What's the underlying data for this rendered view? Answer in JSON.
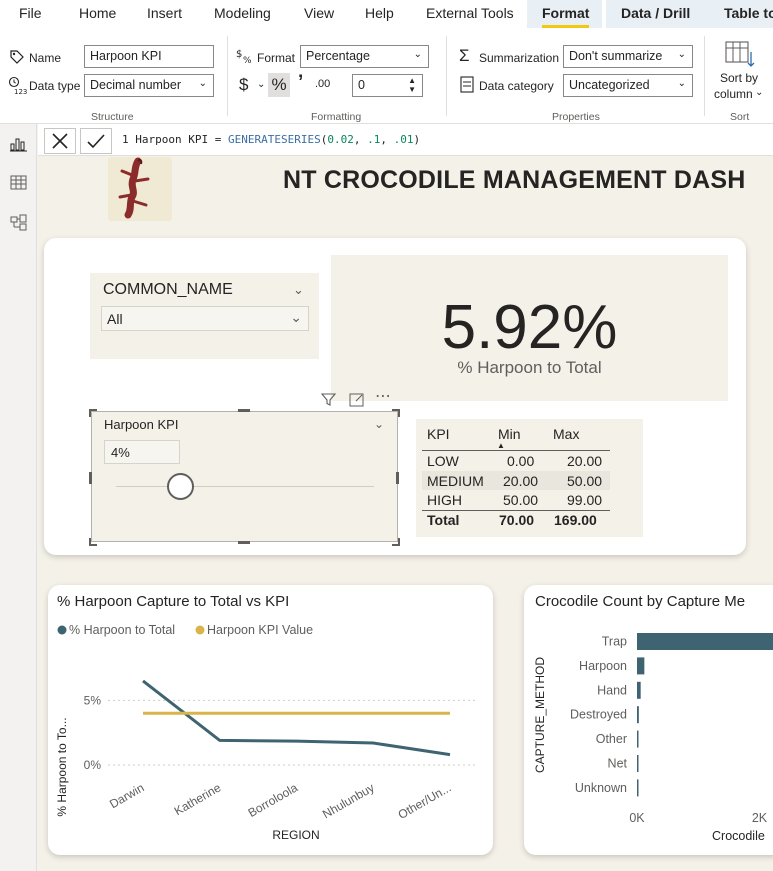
{
  "menu": {
    "items": [
      "File",
      "Home",
      "Insert",
      "Modeling",
      "View",
      "Help",
      "External Tools",
      "Format",
      "Data / Drill",
      "Table to"
    ],
    "active": "Format"
  },
  "ribbon": {
    "structure": {
      "title": "Structure",
      "name_label": "Name",
      "name_value": "Harpoon KPI",
      "datatype_label": "Data type",
      "datatype_value": "Decimal number"
    },
    "formatting": {
      "title": "Formatting",
      "format_label": "Format",
      "format_value": "Percentage",
      "currency_symbol": "$",
      "percent_symbol": "%",
      "comma_symbol": "’",
      "decimals_symbol": ".00",
      "decimals_value": "0"
    },
    "properties": {
      "title": "Properties",
      "summarization_label": "Summarization",
      "summarization_value": "Don't summarize",
      "category_label": "Data category",
      "category_value": "Uncategorized"
    },
    "sort": {
      "title": "Sort",
      "label_line1": "Sort by",
      "label_line2": "column"
    }
  },
  "formula": {
    "line": "1",
    "name": "Harpoon KPI",
    "eq": " = ",
    "fn": "GENERATESERIES",
    "open": "(",
    "a1": "0.02",
    "a2": ".1",
    "a3": ".01",
    "sep": ", ",
    "close": ")"
  },
  "dashboard": {
    "title": "NT CROCODILE MANAGEMENT DASH",
    "slicer": {
      "header": "COMMON_NAME",
      "value": "All"
    },
    "kpi": {
      "value": "5.92%",
      "caption": "% Harpoon to Total"
    },
    "parameter": {
      "title": "Harpoon KPI",
      "value": "4%",
      "level": 0.25
    },
    "kpi_table": {
      "headers": [
        "KPI",
        "Min",
        "Max"
      ],
      "rows": [
        {
          "kpi": "LOW",
          "min": "0.00",
          "max": "20.00"
        },
        {
          "kpi": "MEDIUM",
          "min": "20.00",
          "max": "50.00"
        },
        {
          "kpi": "HIGH",
          "min": "50.00",
          "max": "99.00"
        }
      ],
      "total": {
        "kpi": "Total",
        "min": "70.00",
        "max": "169.00"
      }
    }
  },
  "colors": {
    "series_primary": "#3e6471",
    "series_kpi": "#d9b44a",
    "accent_tab": "#f2c811"
  },
  "chart_data": [
    {
      "type": "line",
      "title": "% Harpoon Capture to Total vs KPI",
      "xlabel": "REGION",
      "ylabel": "% Harpoon to To...",
      "categories": [
        "Darwin",
        "Katherine",
        "Borroloola",
        "Nhulunbuy",
        "Other/Un..."
      ],
      "series": [
        {
          "name": "% Harpoon to Total",
          "values": [
            6.5,
            1.9,
            1.85,
            1.7,
            0.8
          ],
          "color": "#3e6471"
        },
        {
          "name": "Harpoon KPI Value",
          "values": [
            4,
            4,
            4,
            4,
            4
          ],
          "color": "#d9b44a"
        }
      ],
      "yticks": [
        "0%",
        "5%"
      ],
      "ylim": [
        0,
        7.5
      ],
      "grid": true,
      "legend": "top-left"
    },
    {
      "type": "bar",
      "orientation": "horizontal",
      "title": "Crocodile Count by Capture Me",
      "ylabel": "CAPTURE_METHOD",
      "xlabel": "Crocodile",
      "categories": [
        "Trap",
        "Harpoon",
        "Hand",
        "Destroyed",
        "Other",
        "Net",
        "Unknown"
      ],
      "values": [
        2600,
        120,
        60,
        30,
        10,
        8,
        5
      ],
      "xticks": [
        "0K",
        "2K"
      ],
      "xlim": [
        0,
        2400
      ]
    }
  ]
}
